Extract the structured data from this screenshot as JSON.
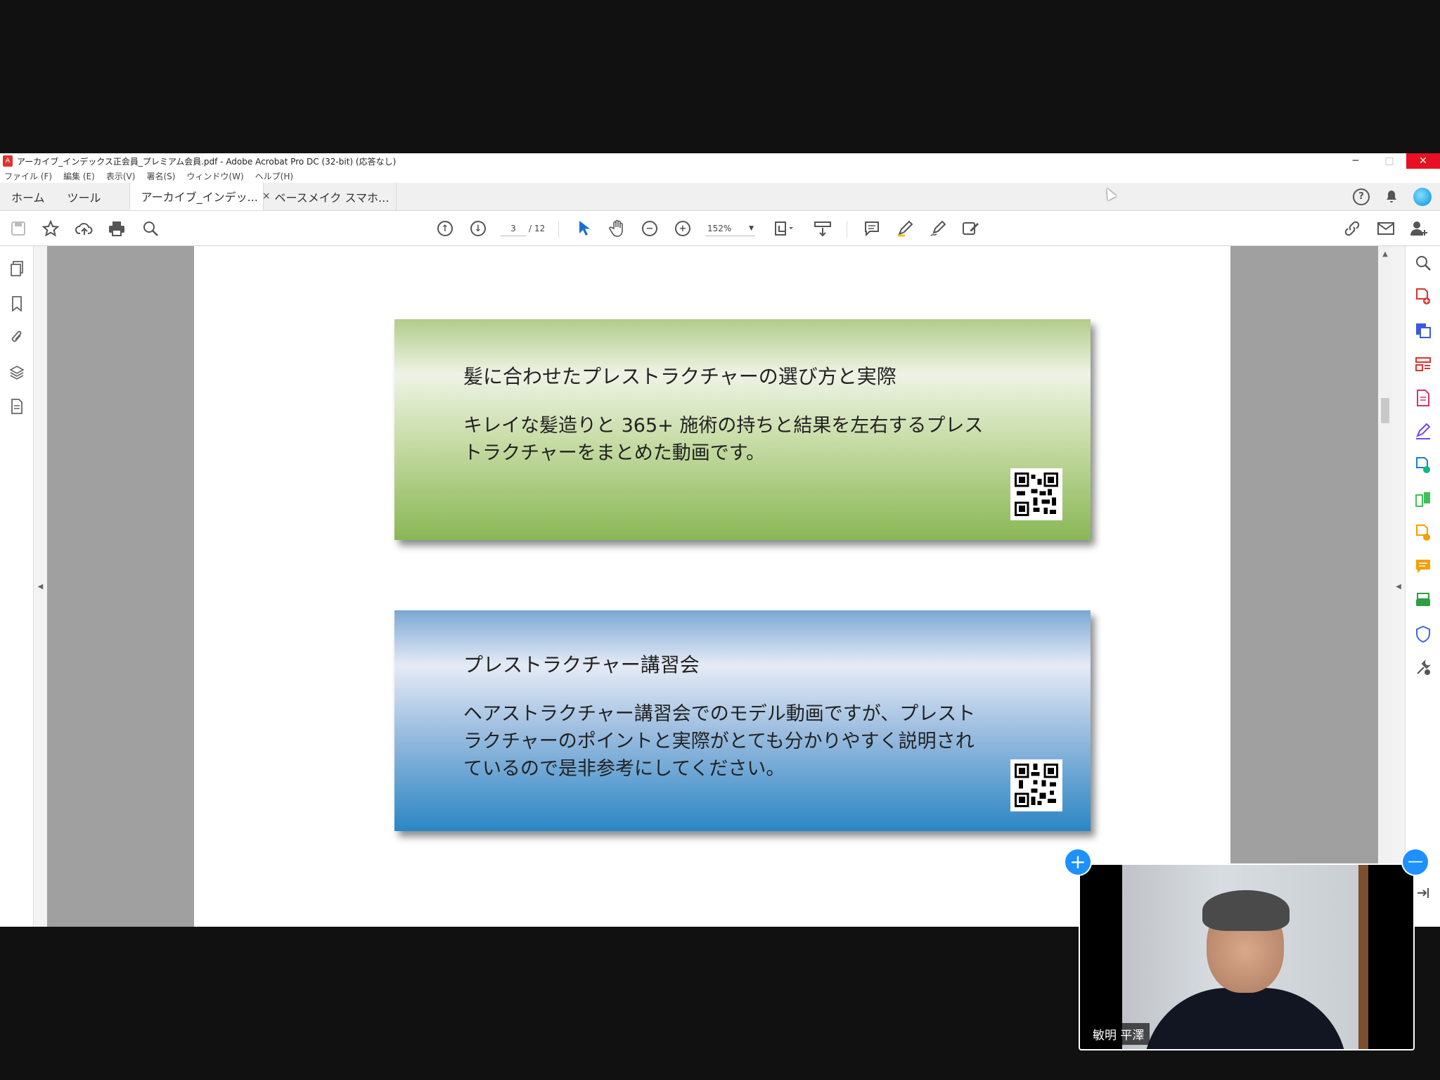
{
  "window": {
    "title": "アーカイブ_インデックス正会員_プレミアム会員.pdf - Adobe Acrobat Pro DC (32-bit) (応答なし)",
    "minimize": "─",
    "maximize": "□",
    "close": "✕"
  },
  "menu": [
    "ファイル (F)",
    "編集 (E)",
    "表示(V)",
    "署名(S)",
    "ウィンドウ(W)",
    "ヘルプ(H)"
  ],
  "tabs": {
    "home": "ホーム",
    "tools": "ツール",
    "doc1": "アーカイブ_インデッ...",
    "doc1_close": "×",
    "doc2": "ベースメイク スマホ..."
  },
  "toolbar": {
    "page_current": "3",
    "page_total": "/ 12",
    "zoom": "152%"
  },
  "cards": [
    {
      "title": "髪に合わせたプレストラクチャーの選び方と実際",
      "body": "キレイな髪造りと 365+ 施術の持ちと結果を左右するプレストラクチャーをまとめた動画です。",
      "color": "#89b755"
    },
    {
      "title": "プレストラクチャー講習会",
      "body": "ヘアストラクチャー講習会でのモデル動画ですが、プレストラクチャーのポイントと実際がとても分かりやすく説明されているので是非参考にしてください。",
      "color": "#2b86c4"
    }
  ],
  "video": {
    "participant_name": "敏明 平澤",
    "add": "+",
    "minimize": "—"
  },
  "icons": {
    "right_tools": [
      "zoom-search-icon",
      "create-pdf-icon",
      "export-pdf-icon",
      "organize-pages-icon",
      "edit-pdf-icon",
      "fill-sign-icon",
      "send-for-signature-icon",
      "compare-files-icon",
      "request-esign-icon",
      "comment-icon",
      "scan-icon",
      "protect-icon",
      "more-tools-icon"
    ],
    "colors": {
      "accent": "#1e90ff",
      "close_red": "#e81123"
    }
  }
}
